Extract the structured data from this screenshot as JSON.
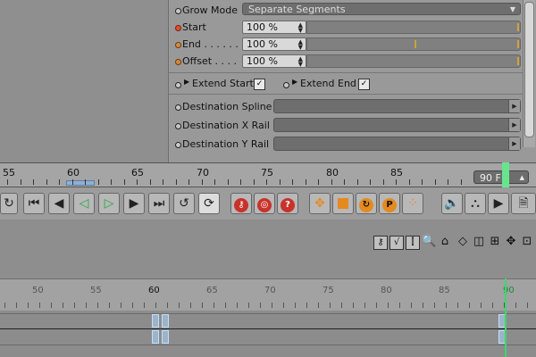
{
  "attributes": {
    "grow_mode": {
      "label": "Grow Mode",
      "value": "Separate Segments"
    },
    "start": {
      "label": "Start",
      "value": "100 %"
    },
    "end": {
      "label": "End",
      "value": "100 %"
    },
    "offset": {
      "label": "Offset",
      "value": "100 %"
    },
    "extend_start": {
      "label": "Extend Start",
      "checked": true
    },
    "extend_end": {
      "label": "Extend End",
      "checked": true
    },
    "destination_spline": {
      "label": "Destination Spline"
    },
    "destination_x_rail": {
      "label": "Destination X Rail"
    },
    "destination_y_rail": {
      "label": "Destination Y Rail"
    }
  },
  "timeline": {
    "ruler_labels": [
      "55",
      "60",
      "65",
      "70",
      "75",
      "80",
      "85"
    ],
    "current_frame": "90 F"
  },
  "dopesheet": {
    "ruler_labels": [
      "50",
      "55",
      "60",
      "65",
      "70",
      "75",
      "80",
      "85",
      "90"
    ],
    "highlight_frame": "60"
  },
  "colors": {
    "accent_green": "#3bd86a",
    "key_blue": "#bfe0ff"
  }
}
